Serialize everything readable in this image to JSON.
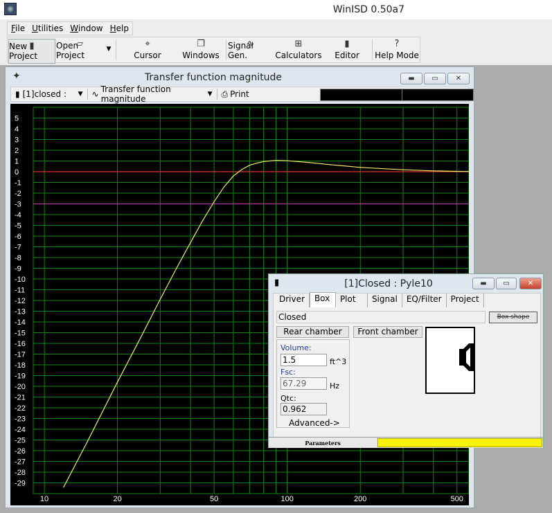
{
  "app": {
    "title": "WinISD 0.50a7"
  },
  "menu": [
    {
      "label": "File",
      "accel": "F"
    },
    {
      "label": "Utilities",
      "accel": "U"
    },
    {
      "label": "Window",
      "accel": "W"
    },
    {
      "label": "Help",
      "accel": "H"
    }
  ],
  "toolbar": {
    "new_project": "New Project",
    "open_project": "Open Project",
    "cursor": "Cursor",
    "windows": "Windows",
    "signal_gen": "Signal Gen.",
    "calculators": "Calculators",
    "editor": "Editor",
    "help_mode": "Help Mode"
  },
  "tf_window": {
    "title": "Transfer function magnitude",
    "project_select": "[1]closed :",
    "plot_select": "Transfer function magnitude",
    "print_label": "Print"
  },
  "chart_data": {
    "type": "line",
    "title": "",
    "xlabel": "",
    "ylabel": "",
    "x_scale": "log",
    "xlim": [
      9,
      560
    ],
    "ylim": [
      -30,
      6
    ],
    "x_ticks": [
      10,
      20,
      50,
      100,
      200,
      500
    ],
    "y_ticks": [
      5,
      4,
      3,
      2,
      1,
      0,
      -1,
      -2,
      -3,
      -4,
      -5,
      -6,
      -7,
      -8,
      -9,
      -10,
      -11,
      -12,
      -13,
      -14,
      -15,
      -16,
      -17,
      -18,
      -19,
      -20,
      -21,
      -22,
      -23,
      -24,
      -25,
      -26,
      -27,
      -28,
      -29
    ],
    "grid": true,
    "reference_lines": [
      {
        "y": 0,
        "color": "#e03030"
      },
      {
        "y": -3,
        "color": "#b03aa8"
      }
    ],
    "series": [
      {
        "color": "#f0f060",
        "x": [
          12,
          15,
          20,
          25,
          30,
          35,
          40,
          45,
          50,
          55,
          60,
          65,
          70,
          75,
          80,
          90,
          100,
          120,
          150,
          200,
          300,
          400,
          500,
          560
        ],
        "y": [
          -29.4,
          -25.2,
          -19.6,
          -15.4,
          -11.9,
          -9.0,
          -6.6,
          -4.5,
          -2.8,
          -1.4,
          -0.4,
          0.2,
          0.6,
          0.8,
          0.95,
          1.05,
          1.02,
          0.88,
          0.66,
          0.4,
          0.18,
          0.08,
          0.03,
          0.02
        ]
      }
    ]
  },
  "box_dialog": {
    "title": "[1]Closed : Pyle10",
    "tabs": [
      "Driver",
      "Box",
      "Plot",
      "Signal",
      "EQ/Filter",
      "Project"
    ],
    "active_tab": "Box",
    "shape": "Closed",
    "box_shape_button": "Box shape",
    "rear_chamber": "Rear chamber",
    "front_chamber": "Front chamber",
    "volume_label": "Volume:",
    "volume_value": "1.5",
    "volume_unit": "ft^3",
    "fsc_label": "Fsc:",
    "fsc_value": "67.29",
    "fsc_unit": "Hz",
    "qtc_label": "Qtc:",
    "qtc_value": "0.962",
    "advanced": "Advanced->",
    "status_tab": "Parameters",
    "status_color": "#f8f200"
  }
}
